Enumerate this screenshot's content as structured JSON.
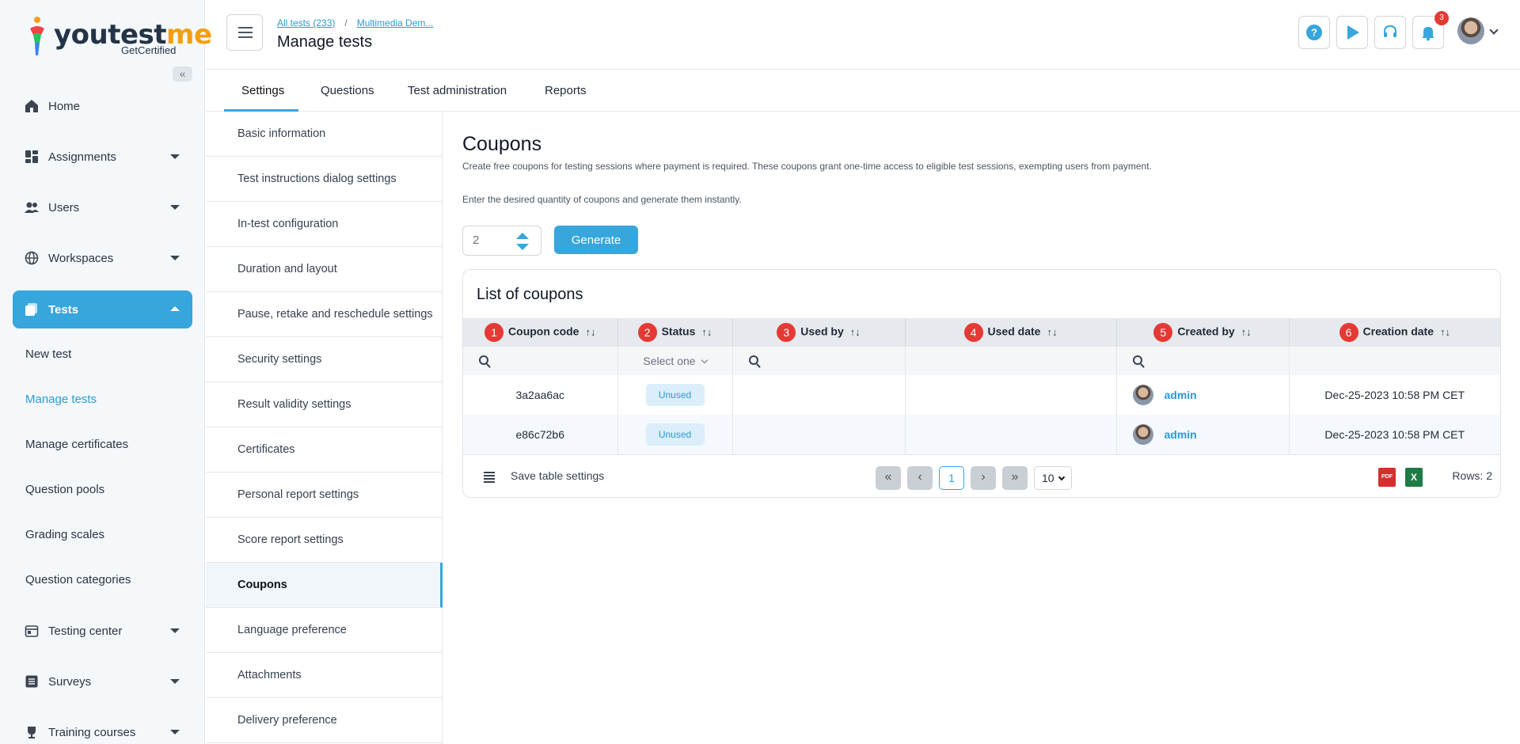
{
  "brand": {
    "name_a": "youtest",
    "name_b": "me",
    "sub": "GetCertified"
  },
  "sidebar": {
    "items": [
      {
        "label": "Home"
      },
      {
        "label": "Assignments"
      },
      {
        "label": "Users"
      },
      {
        "label": "Workspaces"
      },
      {
        "label": "Tests"
      },
      {
        "label": "Testing center"
      },
      {
        "label": "Surveys"
      },
      {
        "label": "Training courses"
      }
    ],
    "subitems": [
      {
        "label": "New test"
      },
      {
        "label": "Manage tests"
      },
      {
        "label": "Manage certificates"
      },
      {
        "label": "Question pools"
      },
      {
        "label": "Grading scales"
      },
      {
        "label": "Question categories"
      }
    ]
  },
  "header": {
    "crumb1": "All tests (233)",
    "crumb_sep": "/",
    "crumb2": "Multimedia Dem...",
    "title": "Manage tests",
    "notifications_count": "3"
  },
  "tabs": [
    {
      "label": "Settings"
    },
    {
      "label": "Questions"
    },
    {
      "label": "Test administration"
    },
    {
      "label": "Reports"
    }
  ],
  "settings_menu": [
    "Basic information",
    "Test instructions dialog settings",
    "In-test configuration",
    "Duration and layout",
    "Pause, retake and reschedule settings",
    "Security settings",
    "Result validity settings",
    "Certificates",
    "Personal report settings",
    "Score report settings",
    "Coupons",
    "Language preference",
    "Attachments",
    "Delivery preference"
  ],
  "content": {
    "title": "Coupons",
    "desc1": "Create free coupons for testing sessions where payment is required. These coupons grant one-time access to eligible test sessions, exempting users from payment.",
    "desc2": "Enter the desired quantity of coupons and generate them instantly.",
    "quantity": "2",
    "generate_label": "Generate",
    "list_title": "List of coupons"
  },
  "table": {
    "columns": [
      {
        "num": "1",
        "label": "Coupon code"
      },
      {
        "num": "2",
        "label": "Status"
      },
      {
        "num": "3",
        "label": "Used by"
      },
      {
        "num": "4",
        "label": "Used date"
      },
      {
        "num": "5",
        "label": "Created by"
      },
      {
        "num": "6",
        "label": "Creation date"
      }
    ],
    "sort_glyph": "↑↓",
    "status_filter": "Select one",
    "rows": [
      {
        "code": "3a2aa6ac",
        "status": "Unused",
        "used_by": "",
        "used_date": "",
        "created_by": "admin",
        "creation_date": "Dec-25-2023 10:58 PM CET"
      },
      {
        "code": "e86c72b6",
        "status": "Unused",
        "used_by": "",
        "used_date": "",
        "created_by": "admin",
        "creation_date": "Dec-25-2023 10:58 PM CET"
      }
    ],
    "footer": {
      "save_label": "Save table settings",
      "current_page": "1",
      "per_page": "10",
      "rows_label": "Rows: 2",
      "pdf_label": "PDF",
      "xls_label": "X"
    }
  },
  "colors": {
    "accent": "#36a6dd",
    "badge_red": "#e53935",
    "pill_bg": "#dbeefa"
  }
}
